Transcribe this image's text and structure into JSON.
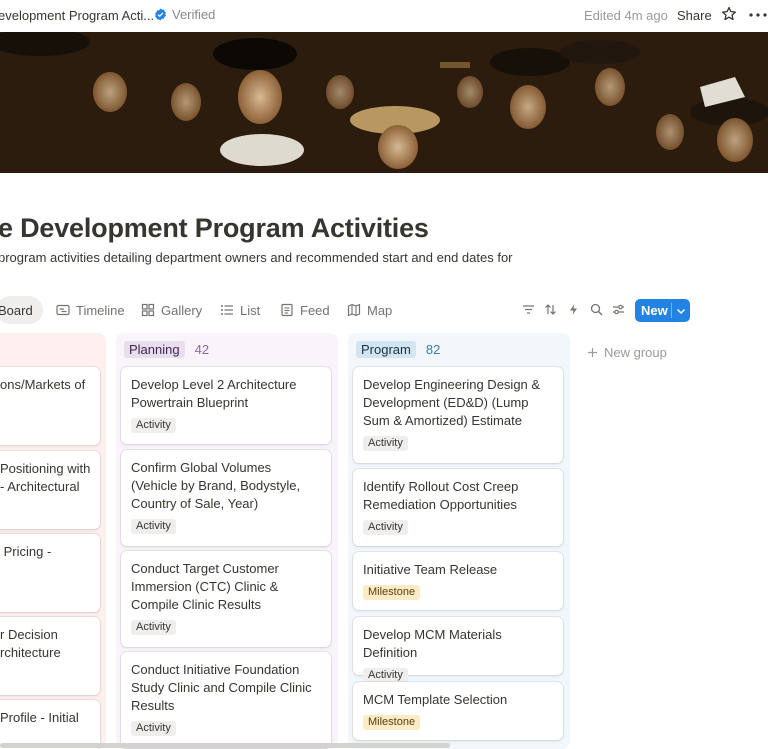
{
  "topbar": {
    "breadcrumb": "evelopment Program Acti...",
    "verified": "Verified",
    "edited": "Edited 4m ago",
    "share": "Share"
  },
  "page": {
    "title": "e Development Program Activities",
    "description": "program activities detailing department owners and recommended start and end dates for"
  },
  "views": [
    {
      "label": "Board",
      "icon": "board-icon"
    },
    {
      "label": "Timeline",
      "icon": "timeline-icon"
    },
    {
      "label": "Gallery",
      "icon": "gallery-icon"
    },
    {
      "label": "List",
      "icon": "list-icon"
    },
    {
      "label": "Feed",
      "icon": "feed-icon"
    },
    {
      "label": "Map",
      "icon": "map-icon"
    }
  ],
  "toolbar": {
    "new_label": "New",
    "icons": [
      "filter-icon",
      "sort-icon",
      "automation-icon",
      "search-icon",
      "settings-icon"
    ]
  },
  "columns": {
    "red": {
      "cards": [
        {
          "title": "ons/Markets of"
        },
        {
          "title": "Positioning with\n- Architectural"
        },
        {
          "title": " Pricing -"
        },
        {
          "title": "r Decision\nrchitecture"
        },
        {
          "title": "Profile - Initial"
        }
      ]
    },
    "planning": {
      "label": "Planning",
      "count": "42",
      "cards": [
        {
          "title": "Develop Level 2 Architecture Powertrain Blueprint",
          "tag": "Activity"
        },
        {
          "title": "Confirm Global Volumes (Vehicle by Brand, Bodystyle, Country of Sale, Year)",
          "tag": "Activity"
        },
        {
          "title": "Conduct Target Customer Immersion (CTC) Clinic & Compile Clinic Results",
          "tag": "Activity"
        },
        {
          "title": "Conduct Initiative Foundation Study Clinic and Compile Clinic Results",
          "tag": "Activity"
        }
      ]
    },
    "program": {
      "label": "Program",
      "count": "82",
      "cards": [
        {
          "title": "Develop Engineering Design & Development (ED&D) (Lump Sum & Amortized) Estimate",
          "tag": "Activity"
        },
        {
          "title": "Identify Rollout Cost Creep Remediation Opportunities",
          "tag": "Activity"
        },
        {
          "title": "Initiative Team Release",
          "tag": "Milestone"
        },
        {
          "title": "Develop MCM Materials Definition",
          "tag": "Activity"
        },
        {
          "title": "MCM Template Selection",
          "tag": "Milestone"
        }
      ]
    }
  },
  "new_group": "New group",
  "colors": {
    "accent": "#2383e2",
    "planning_bg": "#f8f4fa",
    "program_bg": "#f1f7fb",
    "red_bg": "#fdf0ef",
    "milestone_tag": "#fbecc5"
  }
}
